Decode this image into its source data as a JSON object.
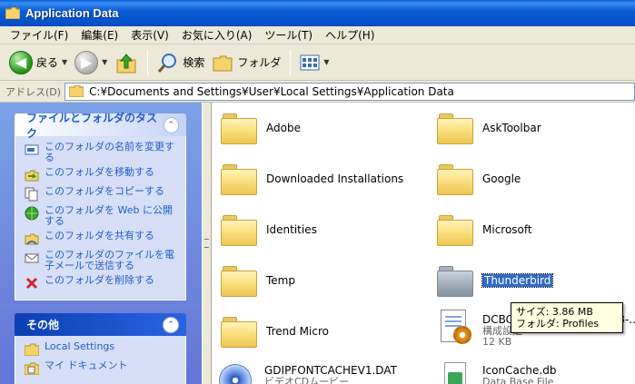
{
  "window": {
    "title": "Application Data"
  },
  "menu": [
    "ファイル(F)",
    "編集(E)",
    "表示(V)",
    "お気に入り(A)",
    "ツール(T)",
    "ヘルプ(H)"
  ],
  "toolbar": {
    "back_label": "戻る",
    "search_label": "検索",
    "folders_label": "フォルダ"
  },
  "address": {
    "label": "アドレス(D)",
    "path": "C:¥Documents and Settings¥User¥Local Settings¥Application Data"
  },
  "tasks_panel": {
    "title": "ファイルとフォルダのタスク",
    "items": [
      {
        "label": "このフォルダの名前を変更する",
        "icon": "rename-icon"
      },
      {
        "label": "このフォルダを移動する",
        "icon": "move-icon"
      },
      {
        "label": "このフォルダをコピーする",
        "icon": "copy-icon"
      },
      {
        "label": "このフォルダを Web に公開する",
        "icon": "web-publish-icon"
      },
      {
        "label": "このフォルダを共有する",
        "icon": "share-icon"
      },
      {
        "label": "このフォルダのファイルを電子メールで送信する",
        "icon": "email-icon"
      },
      {
        "label": "このフォルダを削除する",
        "icon": "delete-icon"
      }
    ]
  },
  "other_panel": {
    "title": "その他",
    "items": [
      {
        "label": "Local Settings",
        "icon": "folder-icon"
      },
      {
        "label": "マイ ドキュメント",
        "icon": "my-documents-icon"
      }
    ]
  },
  "files": {
    "adobe": "Adobe",
    "asktoolbar": "AskToolbar",
    "downloaded": "Downloaded Installations",
    "google": "Google",
    "identities": "Identities",
    "microsoft": "Microsoft",
    "temp": "Temp",
    "thunderbird": "Thunderbird",
    "trendmicro": "Trend Micro",
    "dcbc": {
      "name": "DCBC",
      "name_tail": "-EHR8-...",
      "type": "構成設定",
      "size": "12 KB"
    },
    "gdip": {
      "name": "GDIPFONTCACHEV1.DAT",
      "type": "ビデオCDムービー"
    },
    "iconcache": {
      "name": "IconCache.db",
      "type": "Data Base File"
    }
  },
  "tooltip": {
    "line1": "サイズ: 3.86 MB",
    "line2": "フォルダ: Profiles"
  },
  "colors": {
    "title_blue": "#0554cf",
    "task_link": "#215dc6",
    "selection": "#316ac5"
  }
}
